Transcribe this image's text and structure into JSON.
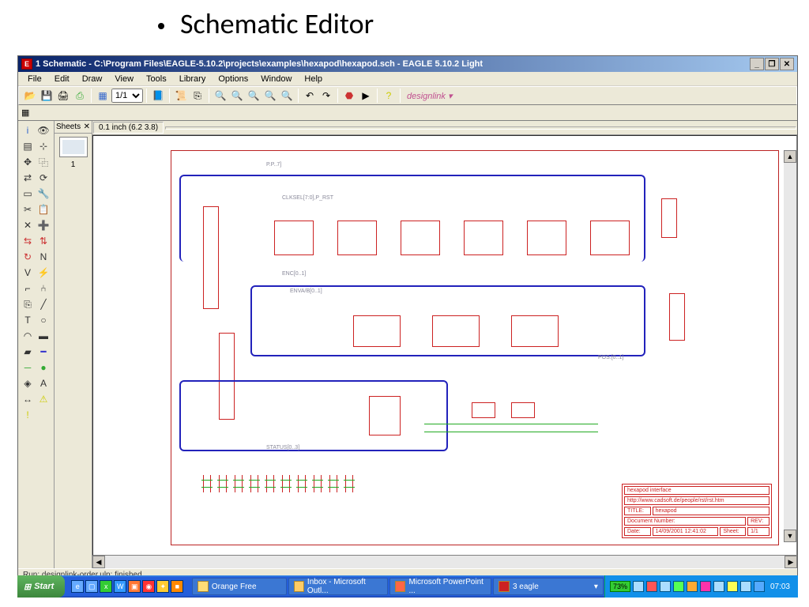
{
  "slide": {
    "title": "Schematic Editor"
  },
  "window": {
    "title": "1 Schematic - C:\\Program Files\\EAGLE-5.10.2\\projects\\examples\\hexapod\\hexapod.sch - EAGLE 5.10.2 Light"
  },
  "menus": [
    "File",
    "Edit",
    "Draw",
    "View",
    "Tools",
    "Library",
    "Options",
    "Window",
    "Help"
  ],
  "toolbar": {
    "zoom_select": "1/1",
    "designlink": "designlink ▾"
  },
  "coord": {
    "text": "0.1 inch (6.2 3.8)"
  },
  "sheets": {
    "title": "Sheets",
    "num": "1"
  },
  "netlabels": {
    "pp": "P.P..7]",
    "clk": "CLKSEL[7:0],P_RST",
    "enc": "ENC[0..1]",
    "enva": "ENVA/B[0..1]",
    "pos": "POS.[0..1]",
    "status": "STATUS[0..3]"
  },
  "titleblock": {
    "line1": "hexapod interface",
    "line2": "http://www.cadsoft.de/people/rst/rst.htm",
    "title_lbl": "TITLE:",
    "title_val": "hexapod",
    "doc_lbl": "Document Number:",
    "rev_lbl": "REV:",
    "date_lbl": "Date:",
    "date_val": "14/09/2001 12:41:02",
    "sheet_lbl": "Sheet:",
    "sheet_val": "1/1"
  },
  "status": "Run: designlink-order.ulp: finished",
  "taskbar": {
    "start": "Start",
    "tasks": [
      {
        "label": "Orange Free"
      },
      {
        "label": "Inbox - Microsoft Outl..."
      },
      {
        "label": "Microsoft PowerPoint ..."
      },
      {
        "label": "3 eagle"
      }
    ],
    "battery": "73%",
    "clock": "07:03"
  }
}
